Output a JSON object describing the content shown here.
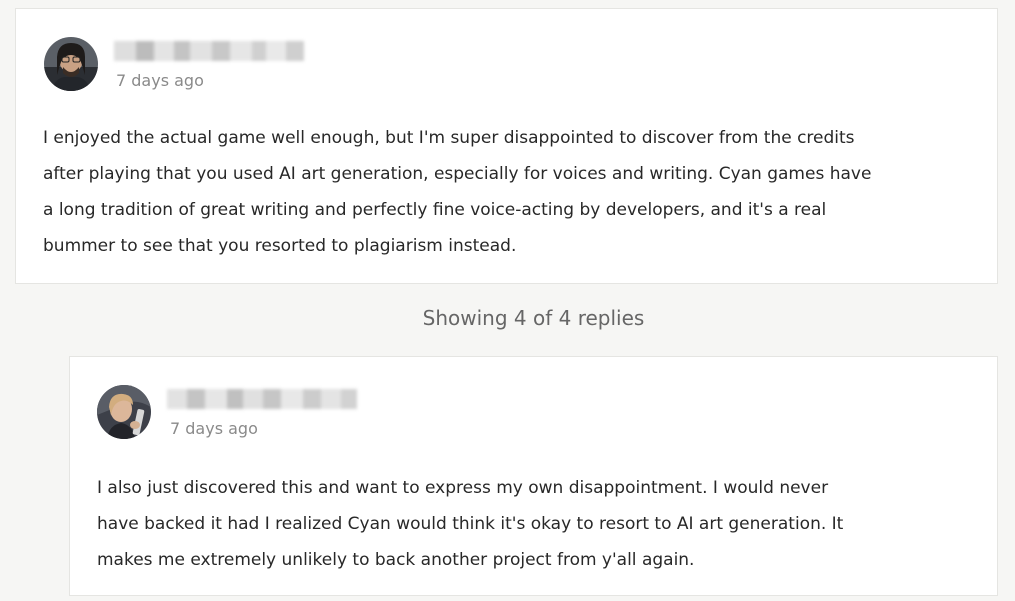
{
  "thread": {
    "replies_label": "Showing 4 of 4 replies"
  },
  "comment": {
    "author_name": "",
    "timestamp": "7 days ago",
    "body": "I enjoyed the actual game well enough, but I'm super disappointed to discover from the credits\nafter playing that you used AI art generation, especially for voices and writing. Cyan games have\na long tradition of great writing and perfectly fine voice-acting by developers, and it's a real\nbummer to see that you resorted to plagiarism instead."
  },
  "reply": {
    "author_name": "",
    "timestamp": "7 days ago",
    "body": "I also just discovered this and want to express my own disappointment. I would never\nhave backed it had I realized Cyan would think it's okay to resort to AI art generation. It\nmakes me extremely unlikely to back another project from y'all again."
  },
  "colors": {
    "page_background": "#f6f6f4",
    "card_background": "#ffffff",
    "card_border": "#e5e5e2",
    "body_text": "#282828",
    "muted_text": "#8a8a8a"
  }
}
